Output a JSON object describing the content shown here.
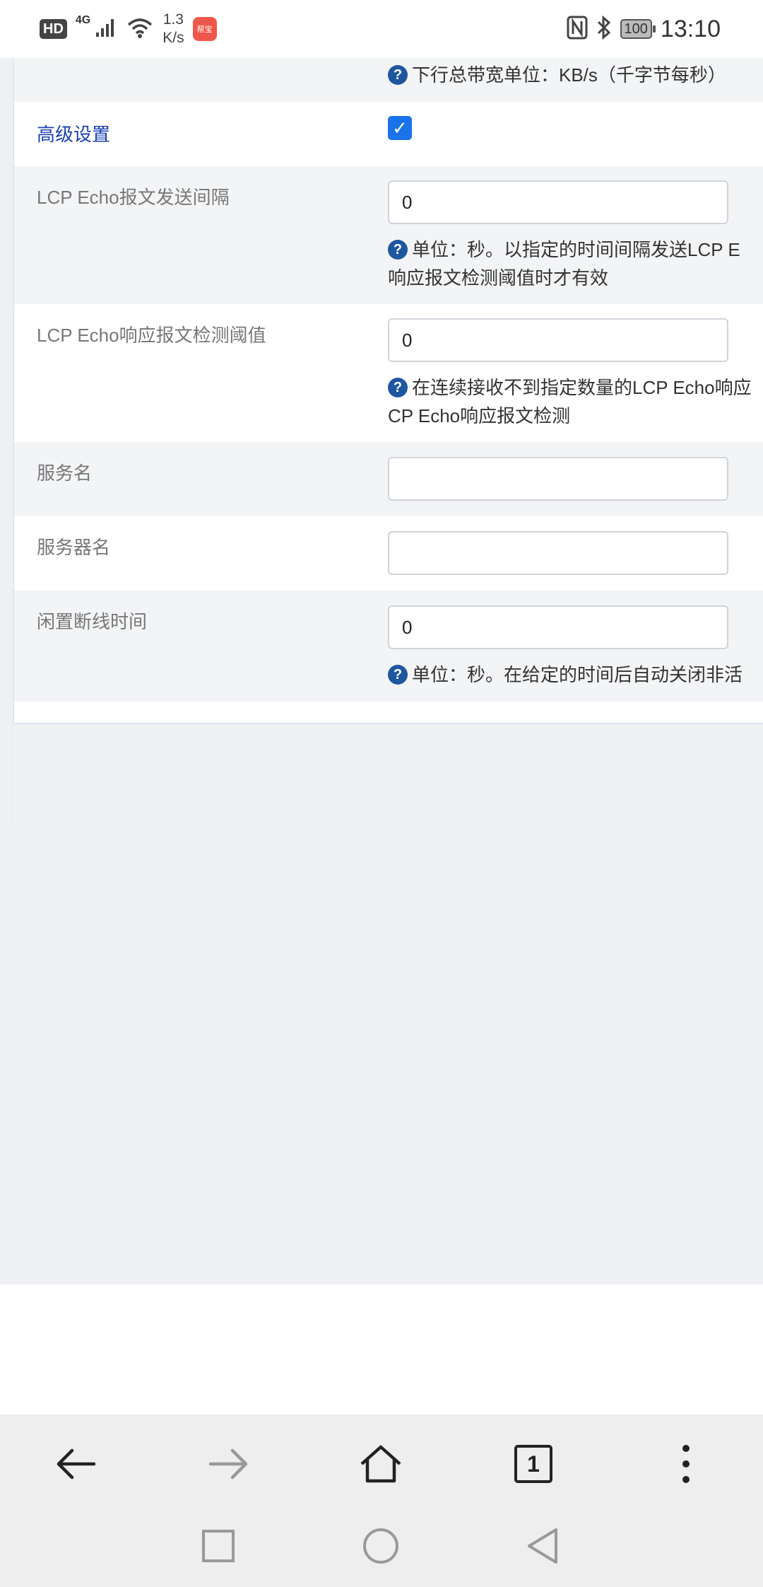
{
  "status_bar": {
    "hd": "HD",
    "network": "4G",
    "speed_value": "1.3",
    "speed_unit": "K/s",
    "app_badge": "帮宝",
    "battery": "100",
    "time": "13:10"
  },
  "form": {
    "downstream_help": "下行总带宽单位：KB/s（千字节每秒）",
    "advanced": {
      "label": "高级设置",
      "checked": true
    },
    "lcp_interval": {
      "label": "LCP Echo报文发送间隔",
      "value": "0",
      "help_line1": "单位：秒。以指定的时间间隔发送LCP E",
      "help_line2": "响应报文检测阈值时才有效"
    },
    "lcp_threshold": {
      "label": "LCP Echo响应报文检测阈值",
      "value": "0",
      "help_line1": "在连续接收不到指定数量的LCP Echo响应",
      "help_line2": "CP Echo响应报文检测"
    },
    "service_name": {
      "label": "服务名",
      "value": ""
    },
    "server_name": {
      "label": "服务器名",
      "value": ""
    },
    "idle_timeout": {
      "label": "闲置断线时间",
      "value": "0",
      "help_line1": "单位：秒。在给定的时间后自动关闭非活"
    }
  },
  "colors": {
    "accent": "#1a73e8",
    "link_label": "#1a3fb5",
    "help_icon": "#1e56a0",
    "page_bg": "#eef0f4"
  },
  "icons": {
    "back": "arrow-left-icon",
    "forward": "arrow-right-icon",
    "home": "home-icon",
    "tabs": "tabs-icon",
    "menu": "more-vertical-icon",
    "recents": "square-icon",
    "home_sys": "circle-icon",
    "back_sys": "triangle-back-icon"
  },
  "browser_bar": {
    "tab_count": "1"
  }
}
